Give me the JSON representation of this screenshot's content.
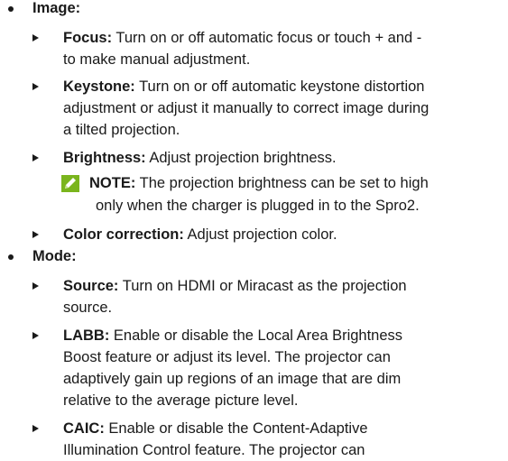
{
  "sections": [
    {
      "heading": "Image:",
      "items": [
        {
          "term": "Focus:",
          "line1": " Turn on or off automatic focus or touch + and -",
          "line2": "to make manual adjustment."
        },
        {
          "term": "Keystone:",
          "line1": " Turn on or off automatic keystone distortion",
          "line2": "adjustment or adjust it manually to correct image during",
          "line3": "a tilted projection."
        },
        {
          "term": "Brightness:",
          "line1": " Adjust projection brightness."
        },
        {
          "term": "Color correction:",
          "line1": " Adjust projection color."
        }
      ],
      "note": {
        "label": "NOTE:",
        "line1": " The projection brightness can be set to high",
        "line2": "only when the charger is plugged in to the Spro2.",
        "icon": "pencil-note-icon",
        "icon_color": "#7ab51d"
      }
    },
    {
      "heading": "Mode:",
      "items": [
        {
          "term": "Source:",
          "line1": " Turn on HDMI or Miracast as the projection",
          "line2": "source."
        },
        {
          "term": "LABB:",
          "line1": " Enable or disable the Local Area Brightness",
          "line2": "Boost feature or adjust its level. The projector can",
          "line3": "adaptively gain up regions of an image that are dim",
          "line4": "relative to the average picture level."
        },
        {
          "term": "CAIC:",
          "line1": " Enable or disable the Content-Adaptive",
          "line2": "Illumination Control feature. The projector can"
        }
      ]
    }
  ]
}
